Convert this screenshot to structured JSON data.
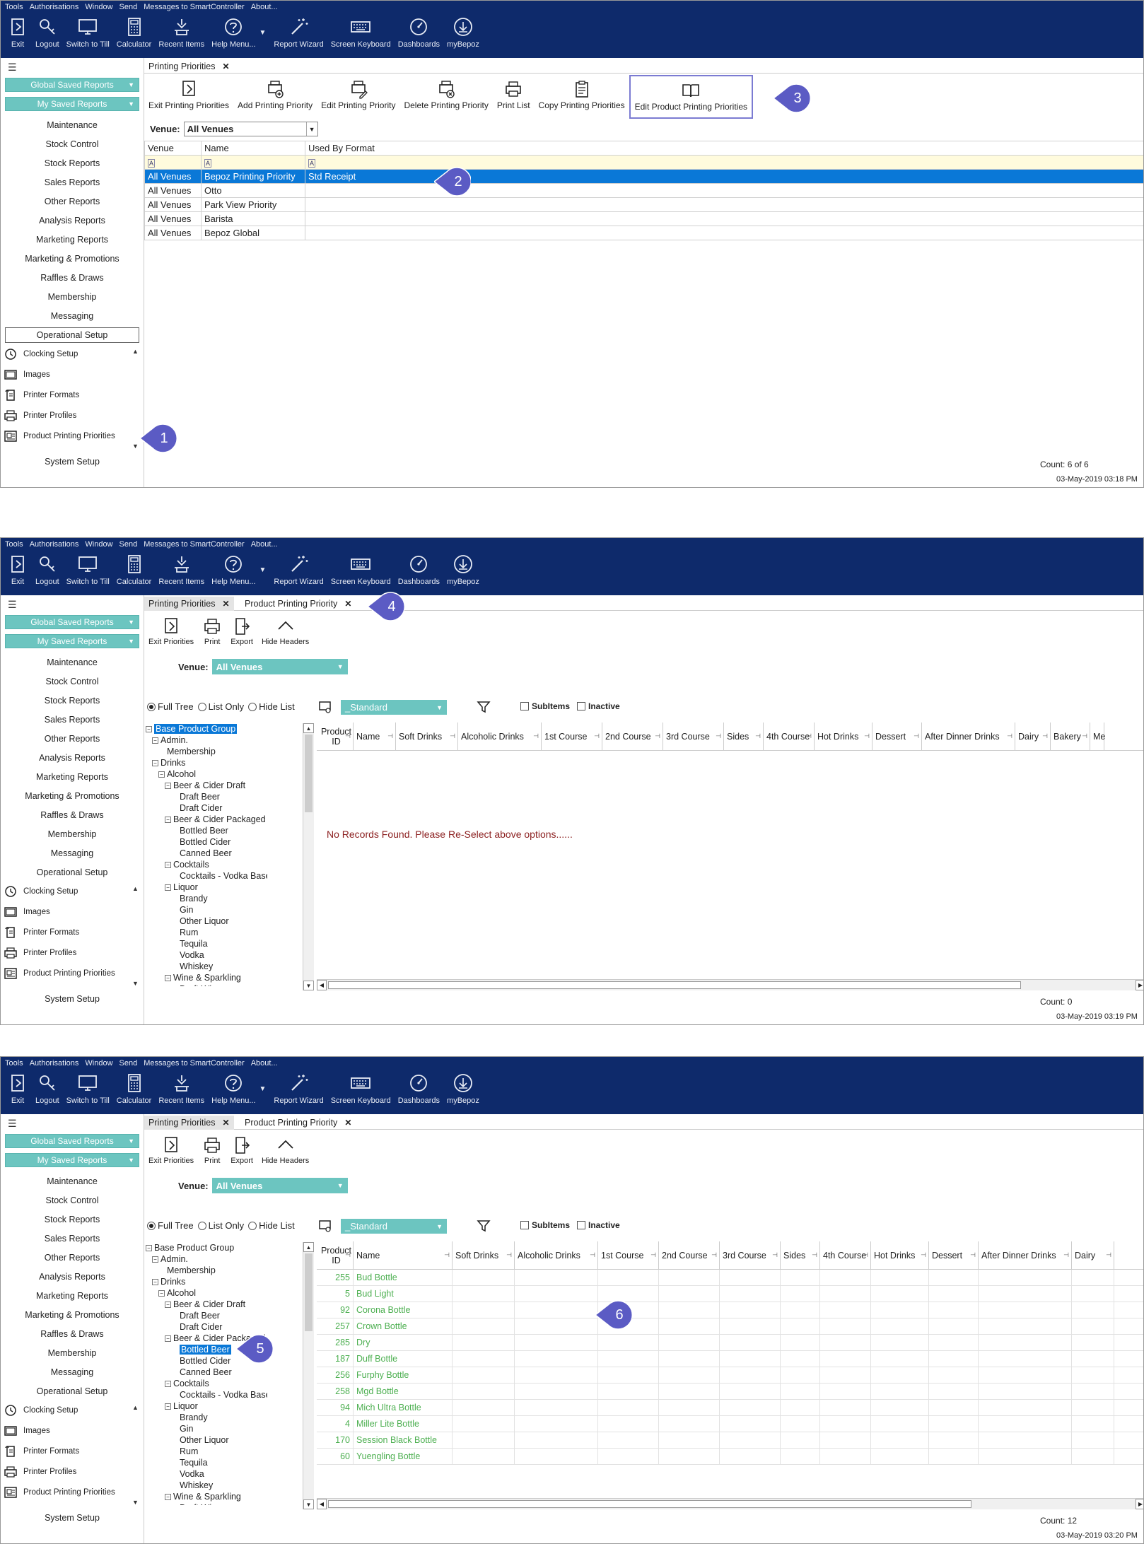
{
  "menu": [
    "Tools",
    "Authorisations",
    "Window",
    "Send",
    "Messages to SmartController",
    "About..."
  ],
  "toolbar": [
    {
      "label": "Exit",
      "icon": "exit-icon"
    },
    {
      "label": "Logout",
      "icon": "key-icon"
    },
    {
      "label": "Switch to Till",
      "icon": "monitor-icon"
    },
    {
      "label": "Calculator",
      "icon": "calculator-icon"
    },
    {
      "label": "Recent Items",
      "icon": "recent-icon"
    },
    {
      "label": "Help Menu...",
      "icon": "help-icon"
    },
    {
      "label": "Report Wizard",
      "icon": "wand-icon"
    },
    {
      "label": "Screen Keyboard",
      "icon": "keyboard-icon"
    },
    {
      "label": "Dashboards",
      "icon": "gauge-icon"
    },
    {
      "label": "myBepoz",
      "icon": "bepoz-icon"
    }
  ],
  "sidebar": {
    "global_saved": "Global Saved Reports",
    "my_saved": "My Saved Reports",
    "links": [
      "Maintenance",
      "Stock Control",
      "Stock Reports",
      "Sales Reports",
      "Other Reports",
      "Analysis Reports",
      "Marketing Reports",
      "Marketing & Promotions",
      "Raffles & Draws",
      "Membership",
      "Messaging",
      "Operational Setup"
    ],
    "icon_items": [
      {
        "label": "Clocking Setup",
        "icon": "clock-icon"
      },
      {
        "label": "Images",
        "icon": "images-icon"
      },
      {
        "label": "Printer Formats",
        "icon": "printer-format-icon"
      },
      {
        "label": "Printer Profiles",
        "icon": "printer-icon"
      },
      {
        "label": "Product Printing Priorities",
        "icon": "priority-icon"
      }
    ],
    "system_setup": "System Setup"
  },
  "panel1": {
    "tab": "Printing Priorities",
    "buttons": [
      "Exit Printing Priorities",
      "Add Printing Priority",
      "Edit Printing Priority",
      "Delete Printing Priority",
      "Print List",
      "Copy Printing Priorities",
      "Edit Product Printing Priorities"
    ],
    "venue_label": "Venue:",
    "venue_value": "All Venues",
    "columns": [
      "Venue",
      "Name",
      "Used By Format"
    ],
    "rows": [
      [
        "All Venues",
        "Bepoz Printing Priority",
        "Std Receipt"
      ],
      [
        "All Venues",
        "Otto",
        ""
      ],
      [
        "All Venues",
        "Park View Priority",
        ""
      ],
      [
        "All Venues",
        "Barista",
        ""
      ],
      [
        "All Venues",
        "Bepoz Global",
        ""
      ]
    ],
    "count": "Count: 6 of 6",
    "datetime": "03-May-2019  03:18 PM"
  },
  "panel2": {
    "tabs": [
      "Printing Priorities",
      "Product Printing Priority"
    ],
    "buttons": [
      "Exit Priorities",
      "Print",
      "Export",
      "Hide Headers"
    ],
    "venue_label": "Venue:",
    "venue_value": "All Venues",
    "radios": [
      "Full Tree",
      "List Only",
      "Hide List"
    ],
    "format": "_Standard",
    "checks": [
      "SubItems",
      "Inactive"
    ],
    "columns": [
      "Product ID",
      "Name",
      "Soft Drinks",
      "Alcoholic Drinks",
      "1st Course",
      "2nd Course",
      "3rd Course",
      "Sides",
      "4th Course",
      "Hot Drinks",
      "Dessert",
      "After Dinner Drinks",
      "Dairy",
      "Bakery",
      "Me"
    ],
    "no_records": "No Records Found. Please Re-Select above options......",
    "count": "Count: 0",
    "datetime": "03-May-2019  03:19 PM"
  },
  "tree": [
    {
      "label": "Base Product Group",
      "level": 0,
      "pm": "-"
    },
    {
      "label": "Admin.",
      "level": 1,
      "pm": "-"
    },
    {
      "label": "Membership",
      "level": 2,
      "pm": ""
    },
    {
      "label": "Drinks",
      "level": 1,
      "pm": "-"
    },
    {
      "label": "Alcohol",
      "level": 2,
      "pm": "-"
    },
    {
      "label": "Beer & Cider Draft",
      "level": 3,
      "pm": "-"
    },
    {
      "label": "Draft Beer",
      "level": 4,
      "pm": ""
    },
    {
      "label": "Draft Cider",
      "level": 4,
      "pm": ""
    },
    {
      "label": "Beer & Cider Packaged",
      "level": 3,
      "pm": "-"
    },
    {
      "label": "Bottled Beer",
      "level": 4,
      "pm": ""
    },
    {
      "label": "Bottled Cider",
      "level": 4,
      "pm": ""
    },
    {
      "label": "Canned Beer",
      "level": 4,
      "pm": ""
    },
    {
      "label": "Cocktails",
      "level": 3,
      "pm": "-"
    },
    {
      "label": "Cocktails - Vodka Based",
      "level": 4,
      "pm": ""
    },
    {
      "label": "Liquor",
      "level": 3,
      "pm": "-"
    },
    {
      "label": "Brandy",
      "level": 4,
      "pm": ""
    },
    {
      "label": "Gin",
      "level": 4,
      "pm": ""
    },
    {
      "label": "Other Liquor",
      "level": 4,
      "pm": ""
    },
    {
      "label": "Rum",
      "level": 4,
      "pm": ""
    },
    {
      "label": "Tequila",
      "level": 4,
      "pm": ""
    },
    {
      "label": "Vodka",
      "level": 4,
      "pm": ""
    },
    {
      "label": "Whiskey",
      "level": 4,
      "pm": ""
    },
    {
      "label": "Wine & Sparkling",
      "level": 3,
      "pm": "-"
    },
    {
      "label": "Draft Wine",
      "level": 4,
      "pm": ""
    }
  ],
  "panel3": {
    "tabs": [
      "Printing Priorities",
      "Product Printing Priority"
    ],
    "buttons": [
      "Exit Priorities",
      "Print",
      "Export",
      "Hide Headers"
    ],
    "venue_label": "Venue:",
    "venue_value": "All Venues",
    "radios": [
      "Full Tree",
      "List Only",
      "Hide List"
    ],
    "format": "_Standard",
    "checks": [
      "SubItems",
      "Inactive"
    ],
    "columns": [
      "Product ID",
      "Name",
      "Soft Drinks",
      "Alcoholic Drinks",
      "1st Course",
      "2nd Course",
      "3rd Course",
      "Sides",
      "4th Course",
      "Hot Drinks",
      "Dessert",
      "After Dinner Drinks",
      "Dairy"
    ],
    "products": [
      [
        "255",
        "Bud Bottle"
      ],
      [
        "5",
        "Bud Light"
      ],
      [
        "92",
        "Corona Bottle"
      ],
      [
        "257",
        "Crown Bottle"
      ],
      [
        "285",
        "Dry"
      ],
      [
        "187",
        "Duff Bottle"
      ],
      [
        "256",
        "Furphy Bottle"
      ],
      [
        "258",
        "Mgd Bottle"
      ],
      [
        "94",
        "Mich Ultra Bottle"
      ],
      [
        "4",
        "Miller Lite Bottle"
      ],
      [
        "170",
        "Session Black Bottle"
      ],
      [
        "60",
        "Yuengling Bottle"
      ]
    ],
    "count": "Count: 12",
    "datetime": "03-May-2019  03:20 PM"
  },
  "callouts": [
    "1",
    "2",
    "3",
    "4",
    "5",
    "6"
  ],
  "colors": {
    "nav": "#0e2a6b",
    "teal": "#6cc5c0",
    "select": "#0a78d7",
    "callout": "#5b5bc4",
    "product": "#4caf50"
  }
}
